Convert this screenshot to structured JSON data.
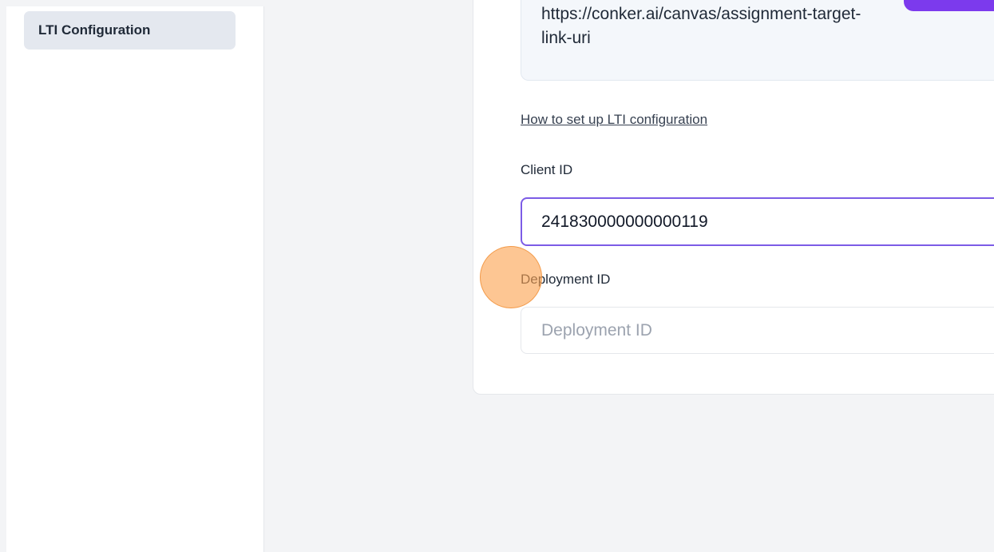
{
  "sidebar": {
    "items": [
      {
        "label": "LTI Configuration",
        "active": true
      }
    ]
  },
  "lti": {
    "target_link_uri": "https://conker.ai/canvas/assignment-target-link-uri",
    "copy_button": {
      "label": "",
      "icon": "copy-icon"
    },
    "help_link": "How to set up LTI configuration",
    "client_id": {
      "label": "Client ID",
      "value": "241830000000000119"
    },
    "deployment_id": {
      "label": "Deployment ID",
      "value": "",
      "placeholder": "Deployment ID"
    }
  },
  "colors": {
    "accent": "#7c3aed",
    "focus_border": "#7c5ce6",
    "sidebar_active_bg": "#e4e8ef",
    "click_indicator": "#fba350"
  }
}
